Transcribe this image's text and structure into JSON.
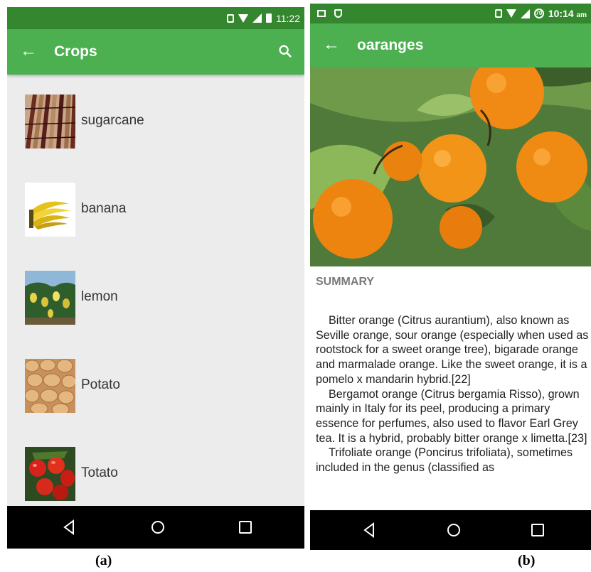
{
  "screen_a": {
    "status": {
      "time": "11:22"
    },
    "appbar": {
      "title": "Crops",
      "back_icon": "arrow-left-icon",
      "search_icon": "search-icon"
    },
    "crops": [
      {
        "label": "sugarcane",
        "thumb": "sugarcane-photo"
      },
      {
        "label": "banana",
        "thumb": "banana-photo"
      },
      {
        "label": "lemon",
        "thumb": "lemon-photo"
      },
      {
        "label": "Potato",
        "thumb": "potato-photo"
      },
      {
        "label": "Totato",
        "thumb": "tomato-photo"
      }
    ],
    "caption": "(a)"
  },
  "screen_b": {
    "status": {
      "time": "10:14",
      "ampm": "am",
      "badge": "70"
    },
    "appbar": {
      "title": "oaranges",
      "back_icon": "arrow-left-icon"
    },
    "summary_heading": "SUMMARY",
    "paragraphs": [
      "Bitter orange (Citrus aurantium), also known as Seville orange, sour orange (especially when used as rootstock for a sweet orange tree), bigarade orange and marmalade orange. Like the sweet orange, it is a pomelo x mandarin hybrid.[22]",
      "Bergamot orange (Citrus bergamia Risso), grown mainly in Italy for its peel, producing a primary essence for perfumes, also used to flavor Earl Grey tea. It is a hybrid, probably bitter orange x limetta.[23]",
      "Trifoliate orange (Poncirus trifoliata), sometimes included in the genus (classified as"
    ],
    "caption": "(b)"
  },
  "colors": {
    "appbar": "#4caf50",
    "statusbar": "#34862f",
    "list_bg": "#ececec",
    "navbar": "#000000"
  }
}
